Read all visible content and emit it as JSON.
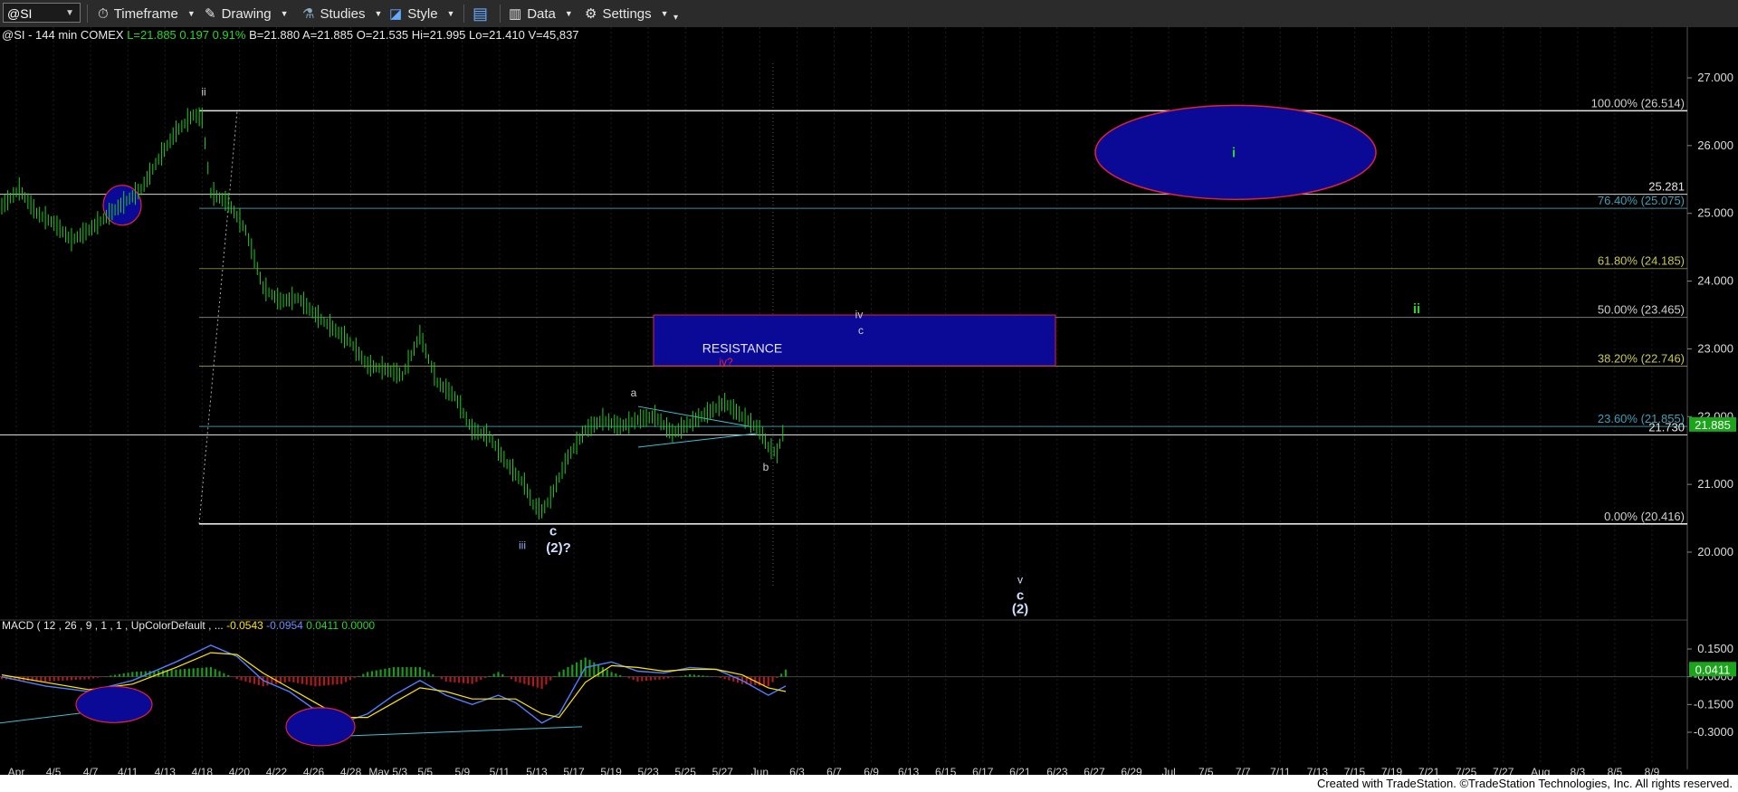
{
  "toolbar": {
    "symbol": "@SI",
    "menus": [
      "Timeframe",
      "Drawing",
      "Studies",
      "Style",
      "Data",
      "Settings"
    ]
  },
  "header": {
    "info": "@SI - 144 min  COMEX",
    "last": "L=21.885",
    "change": "0.197",
    "pct": "0.91%",
    "bid": "B=21.880",
    "ask": "A=21.885",
    "open": "O=21.535",
    "high": "Hi=21.995",
    "low": "Lo=21.410",
    "volume": "V=45,837"
  },
  "footer": "Created with TradeStation. ©TradeStation Technologies, Inc. All rights reserved.",
  "colors": {
    "bars": "#1fcc1f",
    "fib_line": "#cccccc",
    "resistance_fill": "#0a0a96",
    "ellipse_stroke": "#e0223a",
    "macd_line": "#4f7fff",
    "signal_line": "#ffe600",
    "hist_pos": "#1a9a1a",
    "hist_neg": "#b01a1a",
    "last_price_bg": "#1aa51a"
  },
  "chart_data": [
    {
      "type": "line",
      "title": "@SI - 144 min COMEX",
      "xlabel": "",
      "ylabel": "",
      "ylim": [
        19.0,
        27.4
      ],
      "y_ticks": [
        20.0,
        21.0,
        22.0,
        23.0,
        24.0,
        25.0,
        26.0,
        27.0
      ],
      "y_tick_labels": [
        "20.000",
        "21.000",
        "22.000",
        "23.000",
        "24.000",
        "25.000",
        "26.000",
        "27.000"
      ],
      "x_tick_labels": [
        "Apr",
        "4/5",
        "4/7",
        "4/11",
        "4/13",
        "4/18",
        "4/20",
        "4/22",
        "4/26",
        "4/28",
        "May 5/3",
        "5/5",
        "5/9",
        "5/11",
        "5/13",
        "5/17",
        "5/19",
        "5/23",
        "5/25",
        "5/27",
        "Jun",
        "6/3",
        "6/7",
        "6/9",
        "6/13",
        "6/15",
        "6/17",
        "6/21",
        "6/23",
        "6/27",
        "6/29",
        "Jul",
        "7/5",
        "7/7",
        "7/11",
        "7/13",
        "7/15",
        "7/19",
        "7/21",
        "7/25",
        "7/27",
        "Aug",
        "8/3",
        "8/5",
        "8/9"
      ],
      "series": [
        {
          "name": "@SI",
          "points": [
            [
              0,
              25.1
            ],
            [
              2,
              25.35
            ],
            [
              4,
              25.0
            ],
            [
              6,
              24.85
            ],
            [
              8,
              24.6
            ],
            [
              10,
              24.75
            ],
            [
              12,
              24.95
            ],
            [
              14,
              25.15
            ],
            [
              16,
              25.35
            ],
            [
              18,
              25.8
            ],
            [
              20,
              26.2
            ],
            [
              22,
              26.45
            ],
            [
              23,
              26.4
            ],
            [
              24,
              25.3
            ],
            [
              26,
              25.15
            ],
            [
              28,
              24.75
            ],
            [
              30,
              23.9
            ],
            [
              32,
              23.7
            ],
            [
              34,
              23.75
            ],
            [
              36,
              23.5
            ],
            [
              38,
              23.3
            ],
            [
              40,
              23.1
            ],
            [
              42,
              22.75
            ],
            [
              44,
              22.7
            ],
            [
              46,
              22.6
            ],
            [
              48,
              23.2
            ],
            [
              50,
              22.5
            ],
            [
              52,
              22.3
            ],
            [
              54,
              21.8
            ],
            [
              56,
              21.7
            ],
            [
              58,
              21.3
            ],
            [
              60,
              21.0
            ],
            [
              61,
              20.7
            ],
            [
              62,
              20.6
            ],
            [
              63,
              20.8
            ],
            [
              65,
              21.4
            ],
            [
              67,
              21.8
            ],
            [
              69,
              21.95
            ],
            [
              71,
              21.85
            ],
            [
              73,
              21.95
            ],
            [
              75,
              22.0
            ],
            [
              77,
              21.75
            ],
            [
              79,
              21.9
            ],
            [
              81,
              22.05
            ],
            [
              83,
              22.2
            ],
            [
              85,
              22.0
            ],
            [
              87,
              21.8
            ],
            [
              88,
              21.55
            ],
            [
              89,
              21.45
            ],
            [
              90,
              21.9
            ]
          ]
        }
      ],
      "fib_levels": [
        {
          "label": "100.00% (26.514)",
          "value": 26.514
        },
        {
          "label": "76.40% (25.075)",
          "value": 25.075
        },
        {
          "label": "61.80% (24.185)",
          "value": 24.185
        },
        {
          "label": "50.00% (23.465)",
          "value": 23.465
        },
        {
          "label": "38.20% (22.746)",
          "value": 22.746
        },
        {
          "label": "23.60% (21.855)",
          "value": 21.855
        },
        {
          "label": "0.00% (20.416)",
          "value": 20.416
        }
      ],
      "horizontal_levels": [
        {
          "label": "25.281",
          "value": 25.281
        },
        {
          "label": "21.730",
          "value": 21.73
        }
      ],
      "last_price": {
        "label": "21.885",
        "value": 21.885
      },
      "resistance_zone": {
        "label": "RESISTANCE",
        "from": 22.75,
        "to": 23.5
      },
      "annotations": [
        "ii",
        "iii",
        "c",
        "(2)?",
        "a",
        "b",
        "iv?",
        "iv",
        "c",
        "i",
        "ii",
        "v",
        "c",
        "(2)"
      ]
    },
    {
      "type": "line",
      "title": "MACD ( 12 , 26 , 9 , 1 , 1 , UpColorDefault , ...",
      "readouts": [
        "-0.0543",
        "-0.0954",
        "0.0411",
        "0.0000"
      ],
      "ylim": [
        -0.33,
        0.2
      ],
      "y_ticks": [
        0.15,
        0.0,
        -0.15,
        -0.3
      ],
      "y_tick_labels": [
        "0.1500",
        "-0.0000",
        "-0.1500",
        "-0.3000"
      ],
      "last_value": {
        "label": "0.0411",
        "value": 0.0411
      },
      "series": [
        {
          "name": "MACD",
          "points": [
            [
              0,
              0.0
            ],
            [
              5,
              -0.05
            ],
            [
              10,
              -0.08
            ],
            [
              15,
              -0.02
            ],
            [
              20,
              0.08
            ],
            [
              24,
              0.17
            ],
            [
              27,
              0.11
            ],
            [
              30,
              -0.02
            ],
            [
              33,
              -0.08
            ],
            [
              36,
              -0.18
            ],
            [
              39,
              -0.25
            ],
            [
              42,
              -0.2
            ],
            [
              45,
              -0.1
            ],
            [
              48,
              -0.02
            ],
            [
              51,
              -0.1
            ],
            [
              54,
              -0.15
            ],
            [
              57,
              -0.1
            ],
            [
              59,
              -0.14
            ],
            [
              62,
              -0.25
            ],
            [
              64,
              -0.2
            ],
            [
              67,
              0.05
            ],
            [
              70,
              0.08
            ],
            [
              73,
              0.03
            ],
            [
              76,
              0.02
            ],
            [
              79,
              0.05
            ],
            [
              82,
              0.04
            ],
            [
              85,
              -0.02
            ],
            [
              88,
              -0.1
            ],
            [
              90,
              -0.05
            ]
          ]
        },
        {
          "name": "Signal",
          "points": [
            [
              0,
              0.01
            ],
            [
              5,
              -0.03
            ],
            [
              10,
              -0.07
            ],
            [
              15,
              -0.04
            ],
            [
              20,
              0.05
            ],
            [
              24,
              0.13
            ],
            [
              27,
              0.12
            ],
            [
              30,
              0.02
            ],
            [
              33,
              -0.06
            ],
            [
              36,
              -0.14
            ],
            [
              39,
              -0.22
            ],
            [
              42,
              -0.22
            ],
            [
              45,
              -0.14
            ],
            [
              48,
              -0.06
            ],
            [
              51,
              -0.08
            ],
            [
              54,
              -0.12
            ],
            [
              57,
              -0.12
            ],
            [
              59,
              -0.12
            ],
            [
              62,
              -0.2
            ],
            [
              64,
              -0.22
            ],
            [
              67,
              -0.03
            ],
            [
              70,
              0.06
            ],
            [
              73,
              0.05
            ],
            [
              76,
              0.03
            ],
            [
              79,
              0.04
            ],
            [
              82,
              0.04
            ],
            [
              85,
              0.01
            ],
            [
              88,
              -0.06
            ],
            [
              90,
              -0.08
            ]
          ]
        }
      ]
    }
  ]
}
